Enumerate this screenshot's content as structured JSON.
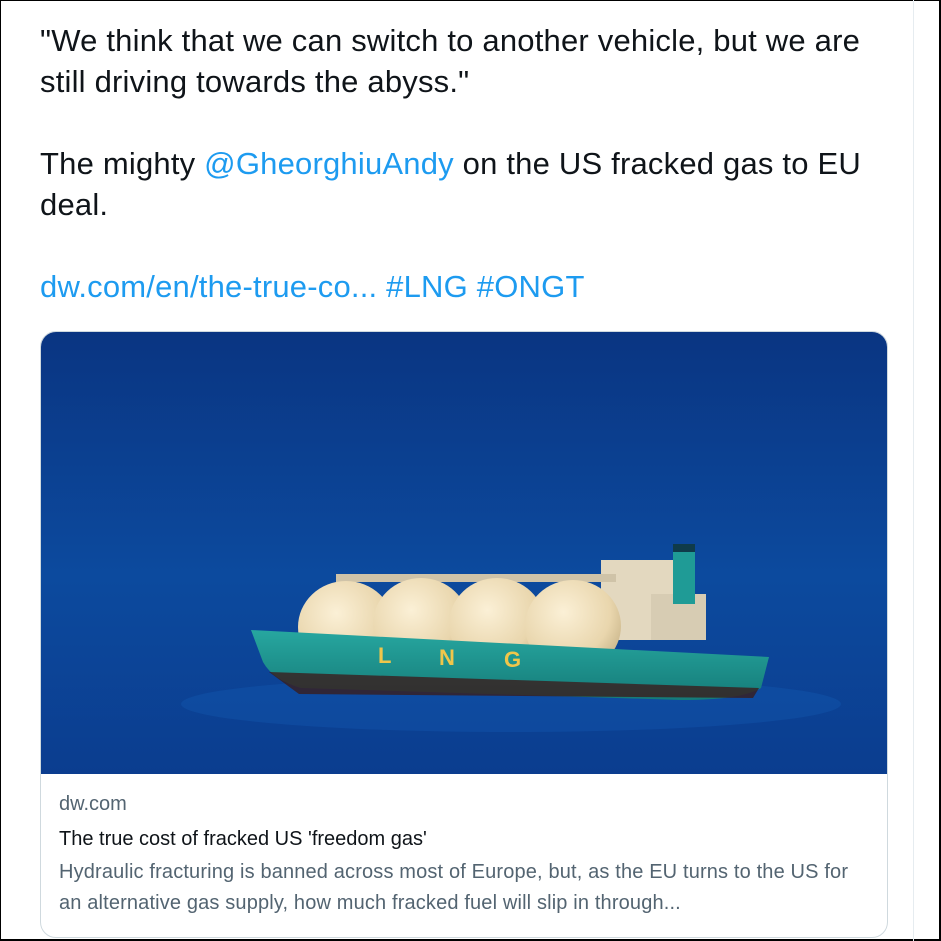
{
  "tweet": {
    "quote_line": "\"We think that we can switch to another vehicle, but we are still driving towards the abyss.\"",
    "intro": "The mighty ",
    "mention": "@GheorghiuAndy",
    "after_mention": " on the US fracked gas to EU deal.",
    "url": "dw.com/en/the-true-co...",
    "hashtags": [
      "#LNG",
      "#ONGT"
    ]
  },
  "card": {
    "image_alt": "LNG tanker ship at sea",
    "ship_lettering": [
      "L",
      "N",
      "G"
    ],
    "domain": "dw.com",
    "title": "The true cost of fracked US 'freedom gas'",
    "description": "Hydraulic fracturing is banned across most of Europe, but, as the EU turns to the US for an alternative gas supply, how much fracked fuel will slip in through..."
  },
  "colors": {
    "link": "#1d9bf0",
    "text": "#0f1419",
    "secondary": "#536471",
    "sea": "#0b3d8f",
    "hull": "#1f9b96"
  }
}
